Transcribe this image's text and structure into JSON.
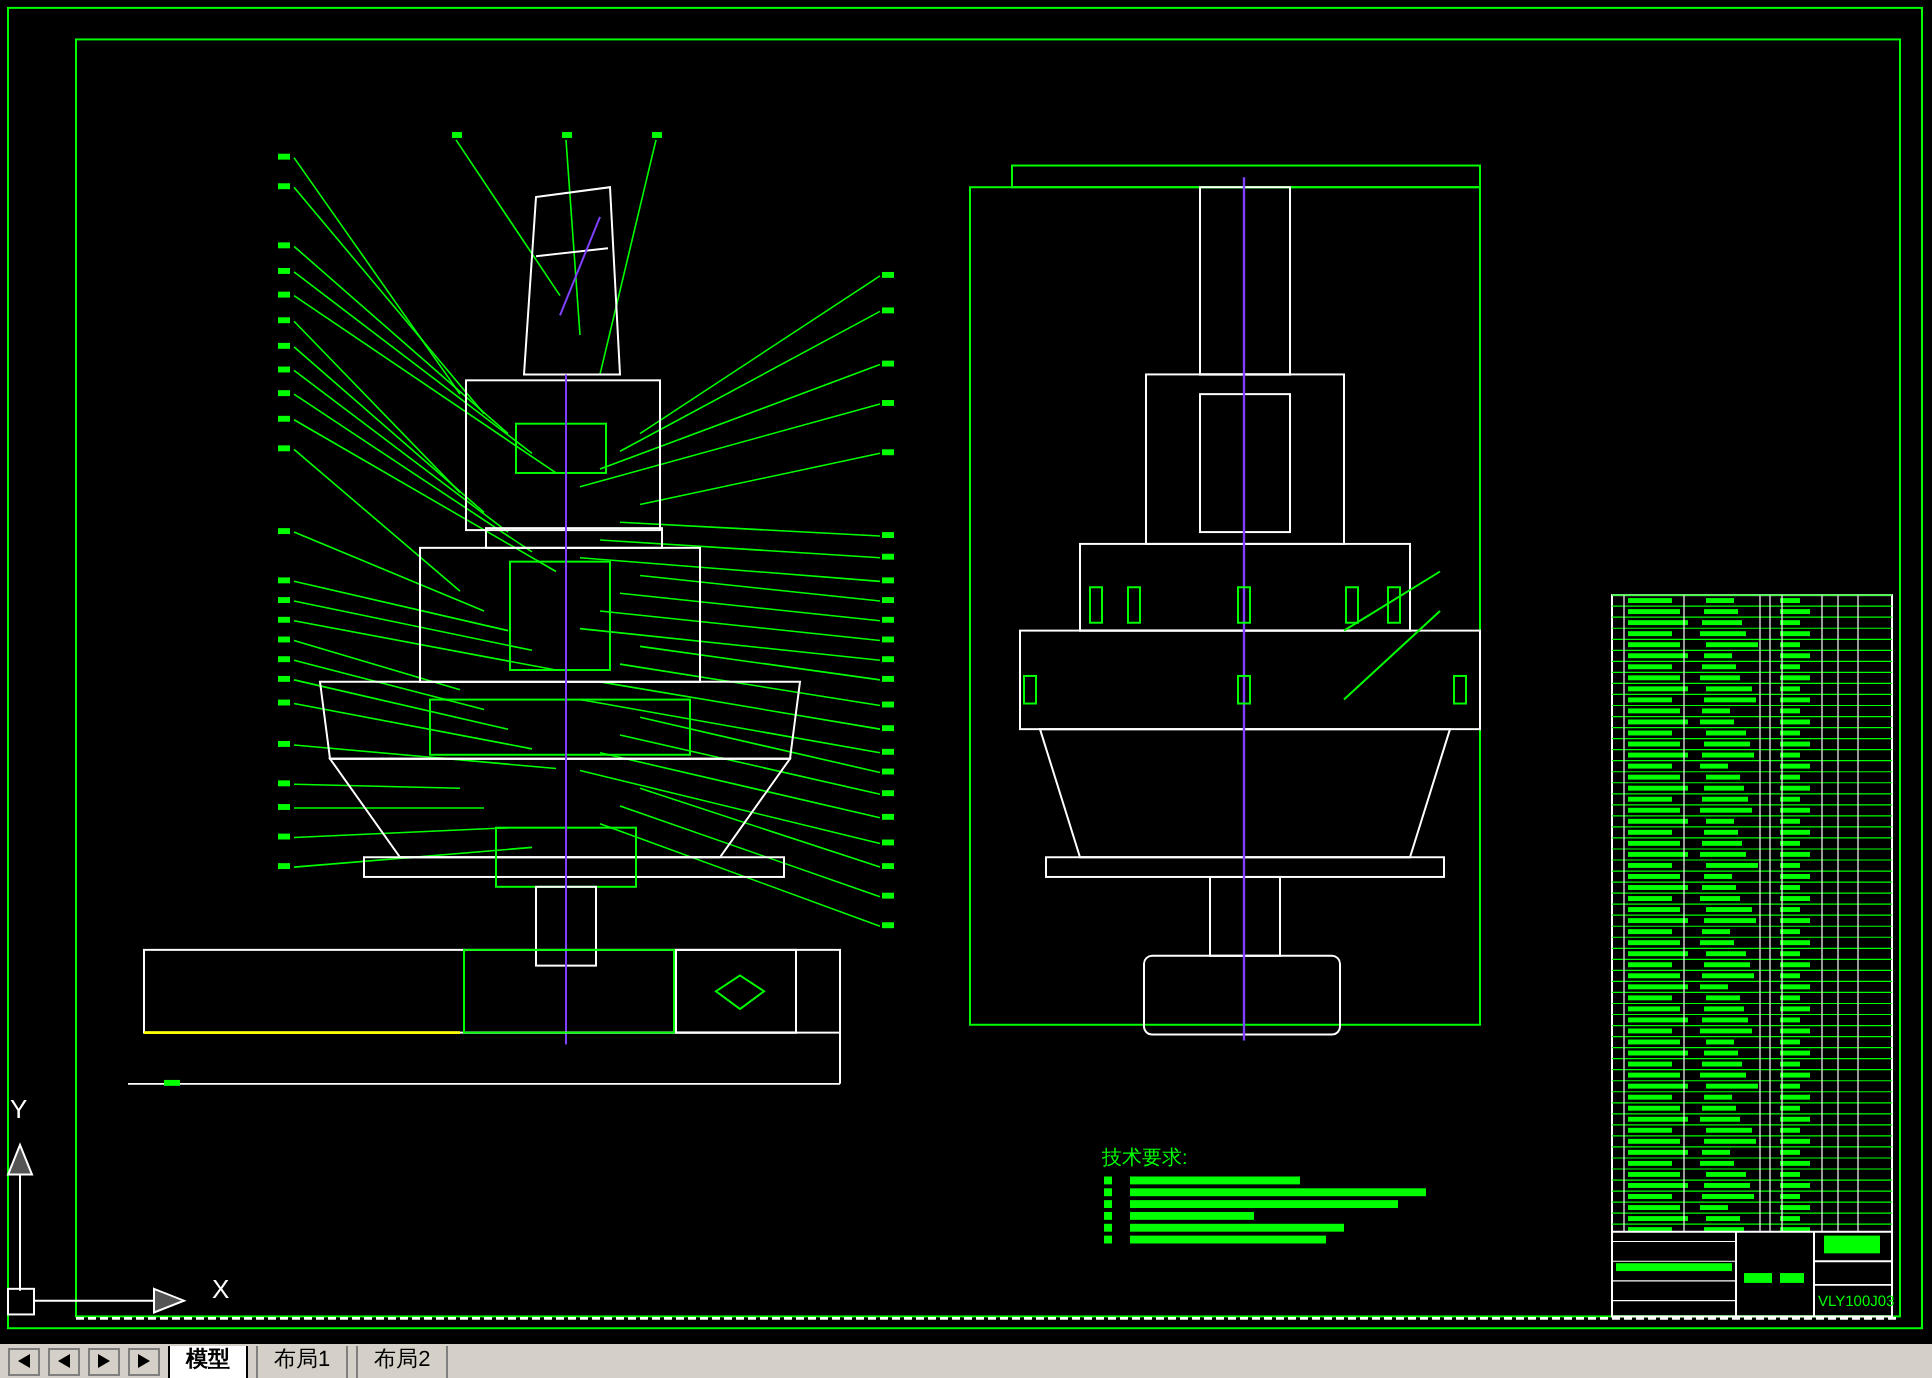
{
  "canvas": {
    "tech_requirements_title": "技术要求:",
    "drawing_number": "VLY100J03",
    "ucs": {
      "x_label": "X",
      "y_label": "Y"
    }
  },
  "layout_tabs": [
    {
      "label": "模型",
      "selected": true
    },
    {
      "label": "布局1",
      "selected": false
    },
    {
      "label": "布局2",
      "selected": false
    }
  ]
}
